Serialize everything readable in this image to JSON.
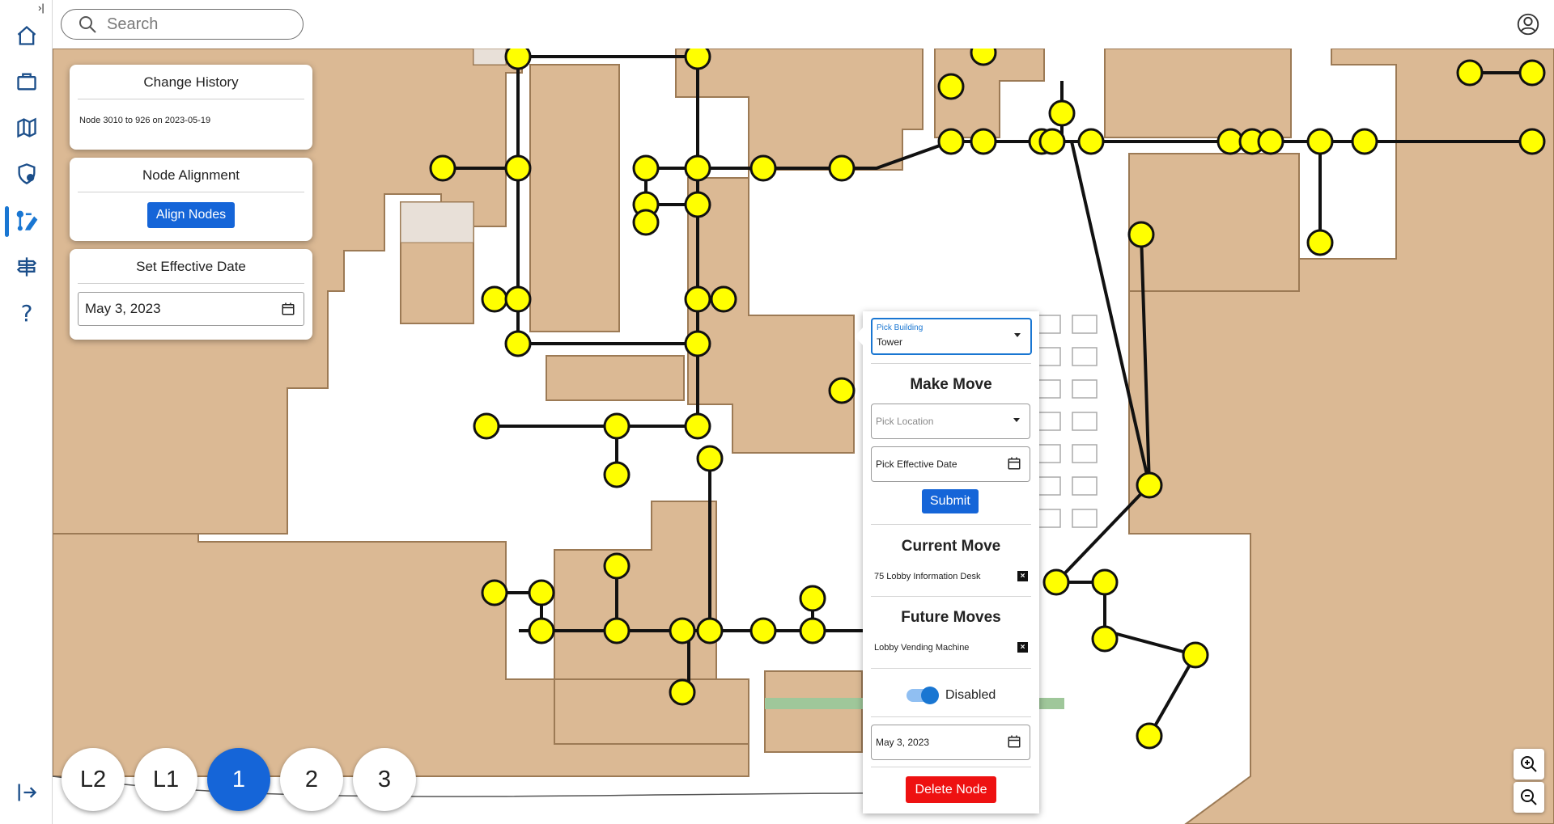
{
  "search": {
    "placeholder": "Search"
  },
  "sidebar": {
    "expand_icon": "›|",
    "items": [
      "home-icon",
      "briefcase-icon",
      "map-icon",
      "shield-person-icon",
      "edit-route-icon",
      "signpost-icon",
      "help-icon"
    ],
    "help_glyph": "?"
  },
  "cards": {
    "history": {
      "title": "Change History",
      "text": "Node 3010 to 926 on 2023-05-19"
    },
    "alignment": {
      "title": "Node Alignment",
      "button": "Align Nodes"
    },
    "effective_date": {
      "title": "Set Effective Date",
      "value": "May 3, 2023"
    }
  },
  "panel": {
    "building": {
      "label": "Pick Building",
      "value": "Tower"
    },
    "make_move": {
      "title": "Make Move",
      "location_placeholder": "Pick Location",
      "date_placeholder": "Pick Effective Date",
      "submit": "Submit"
    },
    "current_move": {
      "title": "Current Move",
      "item": "75 Lobby Information Desk",
      "remove": "×"
    },
    "future_moves": {
      "title": "Future Moves",
      "item": "Lobby Vending Machine",
      "remove": "×"
    },
    "toggle": {
      "label": "Disabled",
      "on": true
    },
    "node_date": "May 3, 2023",
    "delete": "Delete Node"
  },
  "floors": {
    "items": [
      "L2",
      "L1",
      "1",
      "2",
      "3"
    ],
    "active": "1"
  },
  "colors": {
    "accent": "#1565d8",
    "node": "#ffff00",
    "building": "#dbb994",
    "danger": "#ee1111"
  }
}
